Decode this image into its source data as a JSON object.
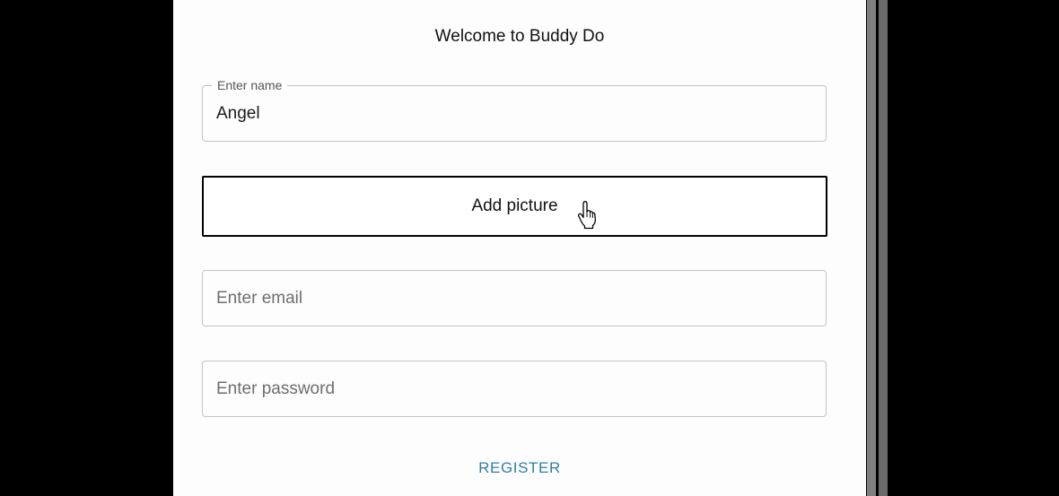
{
  "form": {
    "title": "Welcome to Buddy Do",
    "name_field": {
      "label": "Enter name",
      "value": "Angel"
    },
    "add_picture_label": "Add picture",
    "email_field": {
      "placeholder": "Enter email",
      "value": ""
    },
    "password_field": {
      "placeholder": "Enter password",
      "value": ""
    },
    "register_label": "REGISTER"
  },
  "colors": {
    "background": "#000000",
    "panel": "#fdfdfd",
    "field_border": "#c4c4c4",
    "register_text": "#2f7fa8",
    "scrollbar": "#7f7f7f"
  },
  "icons": {
    "cursor": "hand-pointer-icon"
  }
}
